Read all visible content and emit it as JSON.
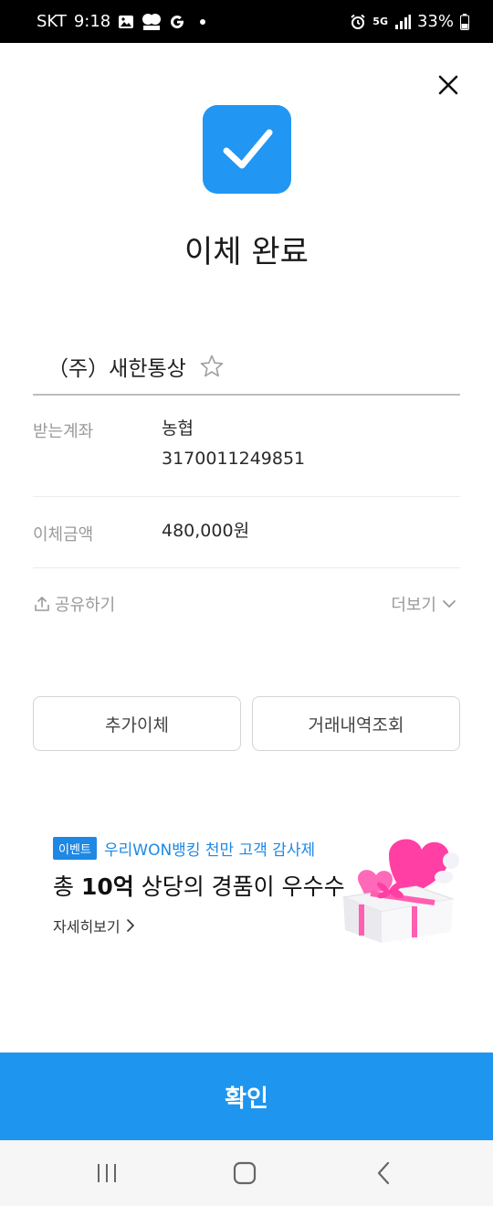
{
  "status_bar": {
    "carrier": "SKT",
    "time": "9:18",
    "network": "5G",
    "battery": "33%"
  },
  "icons": {
    "close": "close-icon",
    "check": "check-icon",
    "star": "star-outline-icon",
    "share": "share-icon",
    "chevron_down": "chevron-down-icon",
    "chevron_right": "chevron-right-icon",
    "recents": "recents-icon",
    "home": "home-icon",
    "back": "back-icon"
  },
  "colors": {
    "accent": "#2196f3",
    "confirm": "#1e96f0",
    "muted": "#9a9a9a"
  },
  "header": {
    "title": "이체 완료"
  },
  "recipient": {
    "name": "（주）새한통상"
  },
  "details": {
    "account_label": "받는계좌",
    "bank": "농협",
    "account_number": "3170011249851",
    "amount_label": "이체금액",
    "amount": "480,000원"
  },
  "actions": {
    "share": "공유하기",
    "more": "더보기",
    "extra_transfer": "추가이체",
    "history": "거래내역조회"
  },
  "banner": {
    "tag": "이벤트",
    "subtitle": "우리WON뱅킹 천만 고객 감사제",
    "headline_prefix": "총 ",
    "headline_bold": "10억",
    "headline_suffix": " 상당의 경품이 우수수",
    "link": "자세히보기"
  },
  "footer": {
    "confirm": "확인"
  }
}
